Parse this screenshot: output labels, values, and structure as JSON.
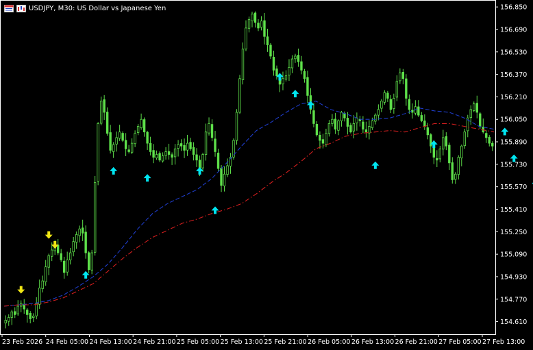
{
  "window": {
    "title": "USDJPY, M30:  US Dollar vs Japanese Yen"
  },
  "colors": {
    "background": "#000000",
    "frame": "#ffffff",
    "candle": "#5ee04a",
    "ma_fast": "#1e3cc8",
    "ma_slow": "#d21e1e",
    "arrow_buy": "#00e5f0",
    "arrow_sell": "#f0e614",
    "axis_text": "#ffffff"
  },
  "chart_data": {
    "type": "candlestick",
    "symbol": "USDJPY",
    "timeframe": "M30",
    "description": "US Dollar vs Japanese Yen",
    "y_ticks": [
      "156.850",
      "156.690",
      "156.530",
      "156.370",
      "156.210",
      "156.050",
      "155.890",
      "155.730",
      "155.570",
      "155.410",
      "155.250",
      "155.090",
      "154.930",
      "154.770",
      "154.610"
    ],
    "x_ticks": [
      "23 Feb 2026",
      "24 Feb 05:00",
      "24 Feb 13:00",
      "24 Feb 21:00",
      "25 Feb 05:00",
      "25 Feb 13:00",
      "25 Feb 21:00",
      "26 Feb 05:00",
      "26 Feb 13:00",
      "26 Feb 21:00",
      "27 Feb 05:00",
      "27 Feb 13:00"
    ],
    "ylim": [
      154.53,
      156.88
    ],
    "close_path": [
      154.62,
      154.64,
      154.68,
      154.66,
      154.72,
      154.74,
      154.7,
      154.66,
      154.63,
      154.65,
      154.74,
      154.85,
      154.9,
      155.0,
      155.08,
      155.12,
      155.15,
      155.1,
      155.05,
      154.96,
      155.05,
      155.1,
      155.18,
      155.23,
      155.27,
      155.24,
      155.1,
      154.98,
      155.1,
      155.6,
      156.02,
      156.18,
      156.1,
      155.95,
      155.83,
      155.87,
      155.92,
      155.96,
      155.9,
      155.84,
      155.82,
      155.88,
      155.95,
      156.0,
      156.05,
      155.96,
      155.88,
      155.82,
      155.78,
      155.8,
      155.76,
      155.79,
      155.82,
      155.8,
      155.78,
      155.84,
      155.87,
      155.86,
      155.83,
      155.88,
      155.84,
      155.8,
      155.76,
      155.7,
      155.8,
      155.96,
      156.02,
      155.92,
      155.82,
      155.7,
      155.58,
      155.66,
      155.72,
      155.78,
      155.9,
      156.1,
      156.34,
      156.55,
      156.7,
      156.76,
      156.8,
      156.74,
      156.7,
      156.75,
      156.64,
      156.58,
      156.5,
      156.4,
      156.36,
      156.3,
      156.34,
      156.36,
      156.42,
      156.48,
      156.5,
      156.46,
      156.4,
      156.34,
      156.22,
      156.12,
      156.02,
      155.94,
      155.9,
      155.88,
      155.95,
      156.02,
      156.05,
      155.98,
      156.04,
      156.1,
      156.06,
      156.0,
      155.96,
      156.02,
      156.06,
      156.04,
      155.98,
      155.96,
      156.0,
      156.04,
      156.08,
      156.12,
      156.18,
      156.24,
      156.2,
      156.12,
      156.2,
      156.32,
      156.38,
      156.34,
      156.2,
      156.12,
      156.1,
      156.14,
      156.08,
      156.04,
      156.0,
      155.94,
      155.86,
      155.78,
      155.76,
      155.84,
      155.92,
      155.86,
      155.74,
      155.62,
      155.66,
      155.78,
      155.86,
      155.96,
      156.06,
      156.12,
      156.16,
      156.1,
      156.0,
      155.96,
      155.92,
      155.88,
      155.86
    ],
    "series": [
      {
        "name": "MA fast",
        "style": "dashed",
        "values": [
          154.72,
          154.73,
          154.74,
          154.76,
          154.8,
          154.86,
          154.93,
          155.02,
          155.14,
          155.27,
          155.38,
          155.45,
          155.5,
          155.55,
          155.63,
          155.74,
          155.86,
          155.97,
          156.03,
          156.1,
          156.16,
          156.18,
          156.12,
          156.09,
          156.05,
          156.05,
          156.06,
          156.09,
          156.13,
          156.11,
          156.1,
          156.06,
          156.0,
          155.98
        ]
      },
      {
        "name": "MA slow",
        "style": "dash-dot",
        "values": [
          154.72,
          154.73,
          154.73,
          154.75,
          154.78,
          154.83,
          154.88,
          154.97,
          155.06,
          155.14,
          155.21,
          155.26,
          155.31,
          155.34,
          155.38,
          155.41,
          155.45,
          155.52,
          155.6,
          155.67,
          155.75,
          155.84,
          155.88,
          155.93,
          155.95,
          155.96,
          155.97,
          155.96,
          155.99,
          156.02,
          156.02,
          156.0,
          155.98,
          155.96
        ]
      }
    ],
    "signals": {
      "buy": [
        {
          "index": 26,
          "price": 154.98
        },
        {
          "index": 35,
          "price": 155.72
        },
        {
          "index": 46,
          "price": 155.67
        },
        {
          "index": 63,
          "price": 155.72
        },
        {
          "index": 68,
          "price": 155.44
        },
        {
          "index": 89,
          "price": 156.39
        },
        {
          "index": 94,
          "price": 156.27
        },
        {
          "index": 99,
          "price": 156.19
        },
        {
          "index": 120,
          "price": 155.76
        },
        {
          "index": 139,
          "price": 155.91
        },
        {
          "index": 162,
          "price": 156.0
        },
        {
          "index": 165,
          "price": 155.81
        },
        {
          "index": 172,
          "price": 155.63
        },
        {
          "index": 182,
          "price": 155.86
        }
      ],
      "sell": [
        {
          "index": 5,
          "price": 154.8
        },
        {
          "index": 14,
          "price": 155.19
        },
        {
          "index": 16,
          "price": 155.12
        }
      ]
    }
  }
}
